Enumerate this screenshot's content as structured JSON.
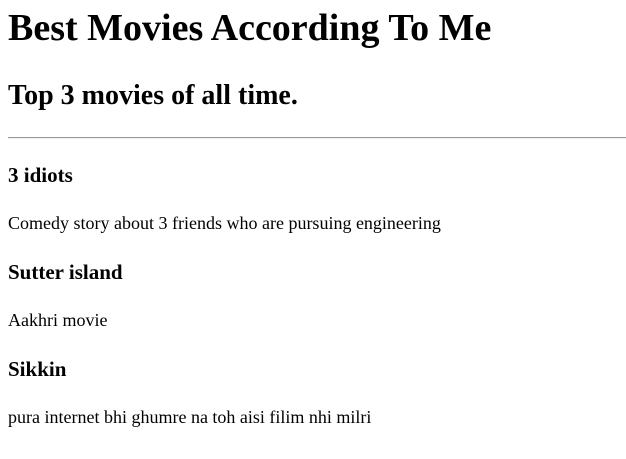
{
  "header": {
    "title": "Best Movies According To Me",
    "subtitle": "Top 3 movies of all time."
  },
  "movies": [
    {
      "title": "3 idiots",
      "description": "Comedy story about 3 friends who are pursuing engineering"
    },
    {
      "title": "Sutter island",
      "description": "Aakhri movie"
    },
    {
      "title": "Sikkin",
      "description": "pura internet bhi ghumre na toh aisi filim nhi milri"
    }
  ]
}
